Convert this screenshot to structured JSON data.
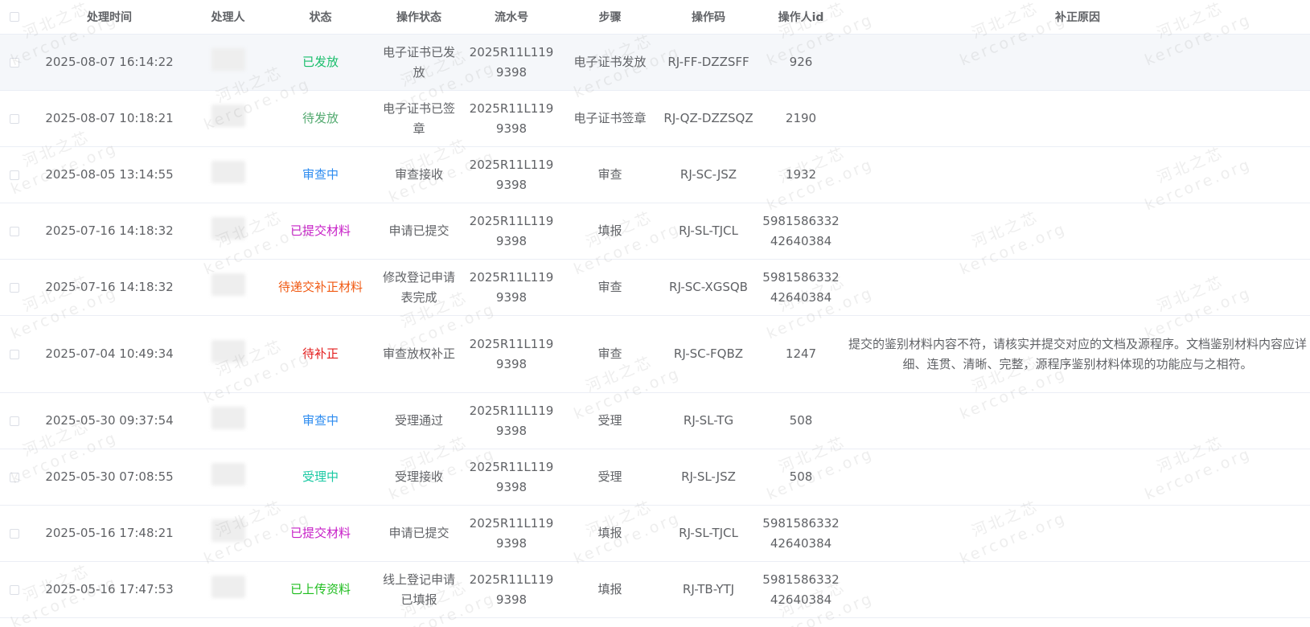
{
  "columns": [
    "处理时间",
    "处理人",
    "状态",
    "操作状态",
    "流水号",
    "步骤",
    "操作码",
    "操作人id",
    "补正原因"
  ],
  "status_colors": {
    "已发放": "#19be6b",
    "待发放": "#52a96f",
    "审查中": "#2d8cf0",
    "已提交材料": "#c71fc7",
    "待递交补正材料": "#f05a13",
    "待补正": "#e31c1c",
    "受理中": "#19c9a3",
    "已上传资料": "#1ebd1e"
  },
  "rows": [
    {
      "time": "2025-08-07 16:14:22",
      "status": "已发放",
      "op_status": "电子证书已发放",
      "serial": "2025R11L1199398",
      "step": "电子证书发放",
      "op_code": "RJ-FF-DZZSFF",
      "operator_id": "926",
      "reason": ""
    },
    {
      "time": "2025-08-07 10:18:21",
      "status": "待发放",
      "op_status": "电子证书已签章",
      "serial": "2025R11L1199398",
      "step": "电子证书签章",
      "op_code": "RJ-QZ-DZZSQZ",
      "operator_id": "2190",
      "reason": ""
    },
    {
      "time": "2025-08-05 13:14:55",
      "status": "审查中",
      "op_status": "审查接收",
      "serial": "2025R11L1199398",
      "step": "审查",
      "op_code": "RJ-SC-JSZ",
      "operator_id": "1932",
      "reason": ""
    },
    {
      "time": "2025-07-16 14:18:32",
      "status": "已提交材料",
      "op_status": "申请已提交",
      "serial": "2025R11L1199398",
      "step": "填报",
      "op_code": "RJ-SL-TJCL",
      "operator_id": "598158633242640384",
      "reason": ""
    },
    {
      "time": "2025-07-16 14:18:32",
      "status": "待递交补正材料",
      "op_status": "修改登记申请表完成",
      "serial": "2025R11L1199398",
      "step": "审查",
      "op_code": "RJ-SC-XGSQB",
      "operator_id": "598158633242640384",
      "reason": ""
    },
    {
      "time": "2025-07-04 10:49:34",
      "status": "待补正",
      "op_status": "审查放权补正",
      "serial": "2025R11L1199398",
      "step": "审查",
      "op_code": "RJ-SC-FQBZ",
      "operator_id": "1247",
      "reason": "提交的鉴别材料内容不符，请核实并提交对应的文档及源程序。文档鉴别材料内容应详细、连贯、清晰、完整，源程序鉴别材料体现的功能应与之相符。"
    },
    {
      "time": "2025-05-30 09:37:54",
      "status": "审查中",
      "op_status": "受理通过",
      "serial": "2025R11L1199398",
      "step": "受理",
      "op_code": "RJ-SL-TG",
      "operator_id": "508",
      "reason": ""
    },
    {
      "time": "2025-05-30 07:08:55",
      "status": "受理中",
      "op_status": "受理接收",
      "serial": "2025R11L1199398",
      "step": "受理",
      "op_code": "RJ-SL-JSZ",
      "operator_id": "508",
      "reason": ""
    },
    {
      "time": "2025-05-16 17:48:21",
      "status": "已提交材料",
      "op_status": "申请已提交",
      "serial": "2025R11L1199398",
      "step": "填报",
      "op_code": "RJ-SL-TJCL",
      "operator_id": "598158633242640384",
      "reason": ""
    },
    {
      "time": "2025-05-16 17:47:53",
      "status": "已上传资料",
      "op_status": "线上登记申请已填报",
      "serial": "2025R11L1199398",
      "step": "填报",
      "op_code": "RJ-TB-YTJ",
      "operator_id": "598158633242640384",
      "reason": ""
    }
  ],
  "watermark": {
    "line1": "河北之芯",
    "line2": "kercore.org"
  }
}
